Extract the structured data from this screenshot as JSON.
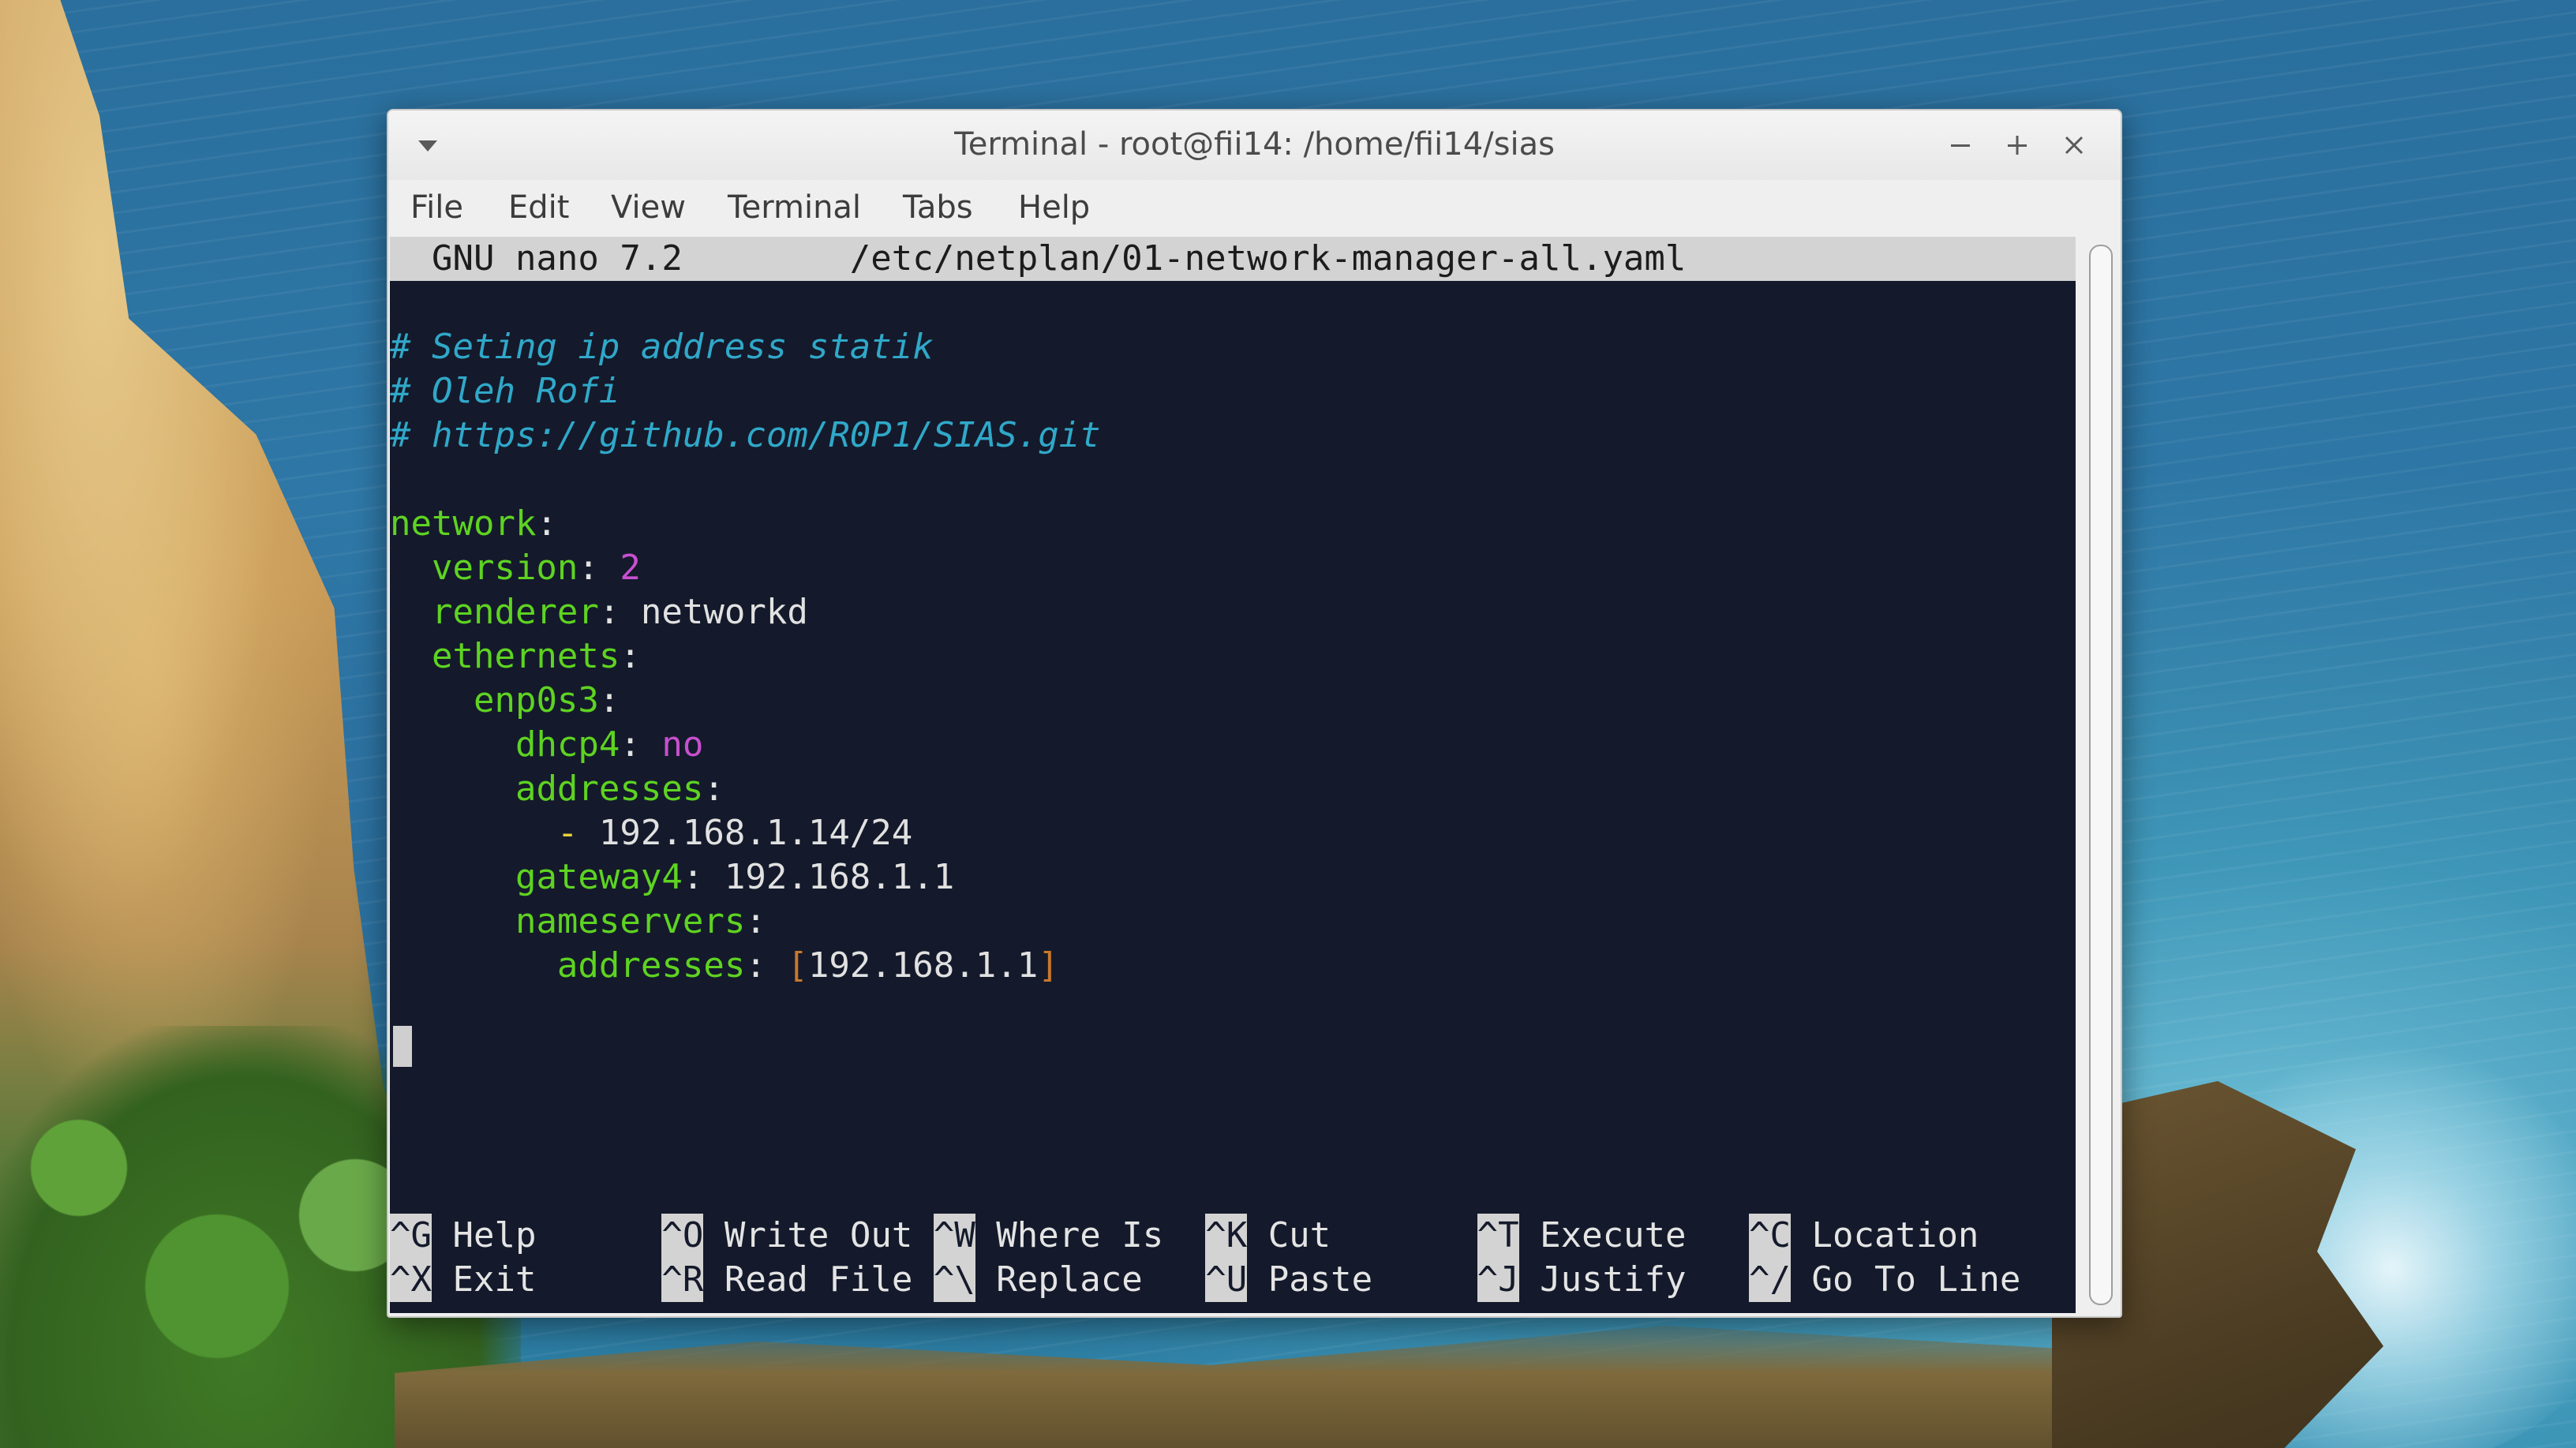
{
  "window": {
    "title": "Terminal - root@fii14: /home/fii14/sias"
  },
  "menubar": {
    "items": [
      "File",
      "Edit",
      "View",
      "Terminal",
      "Tabs",
      "Help"
    ]
  },
  "nano": {
    "header_app": "GNU nano 7.2",
    "header_file": "/etc/netplan/01-network-manager-all.yaml",
    "comments": [
      "# Seting ip address statik",
      "# Oleh Rofi",
      "# https://github.com/R0P1/SIAS.git"
    ],
    "yaml": {
      "network": "network",
      "version_key": "version",
      "version_val": "2",
      "renderer_key": "renderer",
      "renderer_val": "networkd",
      "ethernets_key": "ethernets",
      "iface_key": "enp0s3",
      "dhcp4_key": "dhcp4",
      "dhcp4_val": "no",
      "addresses_key": "addresses",
      "address_dash": "-",
      "address_val": "192.168.1.14/24",
      "gateway4_key": "gateway4",
      "gateway4_val": "192.168.1.1",
      "nameservers_key": "nameservers",
      "ns_addresses_key": "addresses",
      "ns_open": "[",
      "ns_addresses_val": "192.168.1.1",
      "ns_close": "]"
    },
    "shortcuts_row1": [
      {
        "key": "^G",
        "label": "Help"
      },
      {
        "key": "^O",
        "label": "Write Out"
      },
      {
        "key": "^W",
        "label": "Where Is"
      },
      {
        "key": "^K",
        "label": "Cut"
      },
      {
        "key": "^T",
        "label": "Execute"
      },
      {
        "key": "^C",
        "label": "Location"
      }
    ],
    "shortcuts_row2": [
      {
        "key": "^X",
        "label": "Exit"
      },
      {
        "key": "^R",
        "label": "Read File"
      },
      {
        "key": "^\\",
        "label": "Replace"
      },
      {
        "key": "^U",
        "label": "Paste"
      },
      {
        "key": "^J",
        "label": "Justify"
      },
      {
        "key": "^/",
        "label": "Go To Line"
      }
    ]
  }
}
